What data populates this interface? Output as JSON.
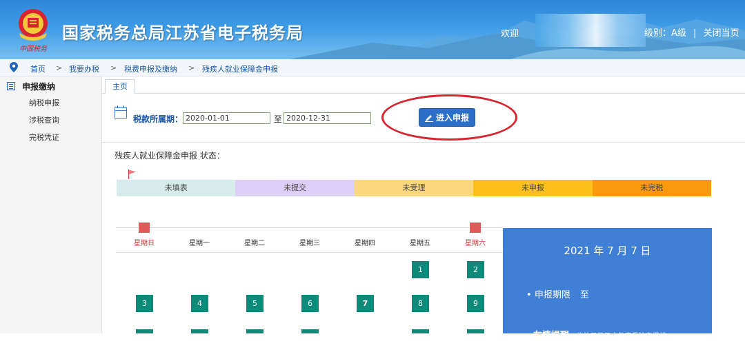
{
  "header": {
    "site_title": "国家税务总局江苏省电子税务局",
    "logo_caption": "中国税务",
    "welcome": "欢迎",
    "credit_level": "级别：A级",
    "separator": "|",
    "close_page": "关闭当页",
    "colors": {
      "title_bg": "#3d9be6"
    }
  },
  "breadcrumb": {
    "items": [
      "首页",
      "我要办税",
      "税费申报及缴纳",
      "残疾人就业保障金申报"
    ],
    "arrow": ">"
  },
  "sidebar": {
    "heading": "申报缴纳",
    "items": [
      "纳税申报",
      "涉税查询",
      "完税凭证"
    ]
  },
  "tabs": {
    "home": "主页"
  },
  "period": {
    "label": "税款所属期：",
    "start": "2020-01-01",
    "to": "至",
    "end": "2020-12-31"
  },
  "enter_button": "进入申报",
  "status": {
    "title": "残疾人就业保障金申报 状态：",
    "segments": [
      {
        "label": "未填表",
        "color": "#d5ecea"
      },
      {
        "label": "未提交",
        "color": "#dccef6"
      },
      {
        "label": "未受理",
        "color": "#fdd77d"
      },
      {
        "label": "未申报",
        "color": "#fdc11d"
      },
      {
        "label": "未完税",
        "color": "#fb9a0d"
      }
    ]
  },
  "calendar": {
    "weekdays": [
      "星期日",
      "星期一",
      "星期二",
      "星期三",
      "星期四",
      "星期五",
      "星期六"
    ],
    "week1": [
      "1",
      "2"
    ],
    "week2": [
      "3",
      "4",
      "5",
      "6",
      "7",
      "8",
      "9"
    ],
    "today": "7",
    "colors": {
      "day": "#0f8a7a",
      "weekend_text": "#d03a3a"
    }
  },
  "info_panel": {
    "date": "2021 年 7 月 7 日",
    "deadline_label": "申报期限",
    "deadline_value": "至",
    "bottom_label": "友情提醒",
    "bottom_text": "此处只显示本年度系统申报状",
    "color": "#3f7fd6"
  }
}
